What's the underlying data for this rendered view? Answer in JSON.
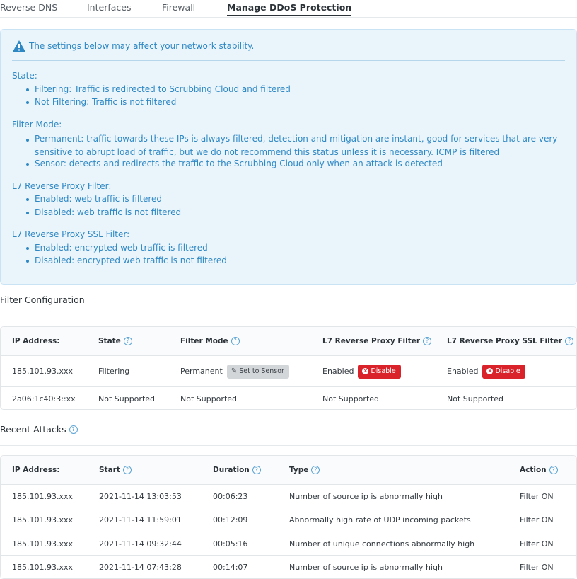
{
  "tabs": [
    {
      "label": "Reverse DNS"
    },
    {
      "label": "Interfaces"
    },
    {
      "label": "Firewall"
    },
    {
      "label": "Manage DDoS Protection"
    }
  ],
  "alert": {
    "warning": "The settings below may affect your network stability.",
    "sections": [
      {
        "title": "State:",
        "items": [
          "Filtering: Traffic is redirected to Scrubbing Cloud and filtered",
          "Not Filtering: Traffic is not filtered"
        ]
      },
      {
        "title": "Filter Mode:",
        "items": [
          "Permanent: traffic towards these IPs is always filtered, detection and mitigation are instant, good for services that are very sensitive to abrupt load of traffic, but we do not recommend this status unless it is necessary. ICMP is filtered",
          "Sensor: detects and redirects the traffic to the Scrubbing Cloud only when an attack is detected"
        ]
      },
      {
        "title": "L7 Reverse Proxy Filter:",
        "items": [
          "Enabled: web traffic is filtered",
          "Disabled: web traffic is not filtered"
        ]
      },
      {
        "title": "L7 Reverse Proxy SSL Filter:",
        "items": [
          "Enabled: encrypted web traffic is filtered",
          "Disabled: encrypted web traffic is not filtered"
        ]
      }
    ]
  },
  "filter_config": {
    "title": "Filter Configuration",
    "headers": [
      "IP Address:",
      "State",
      "Filter Mode",
      "L7 Reverse Proxy Filter",
      "L7 Reverse Proxy SSL Filter"
    ],
    "rows": [
      {
        "ip": "185.101.93.xxx",
        "state": "Filtering",
        "mode": "Permanent",
        "mode_button": "Set to Sensor",
        "l7": "Enabled",
        "l7_button": "Disable",
        "l7ssl": "Enabled",
        "l7ssl_button": "Disable"
      },
      {
        "ip": "2a06:1c40:3::xx",
        "state": "Not Supported",
        "mode": "Not Supported",
        "l7": "Not Supported",
        "l7ssl": "Not Supported"
      }
    ]
  },
  "recent_attacks": {
    "title": "Recent Attacks",
    "headers": [
      "IP Address:",
      "Start",
      "Duration",
      "Type",
      "Action"
    ],
    "rows": [
      {
        "ip": "185.101.93.xxx",
        "start": "2021-11-14 13:03:53",
        "duration": "00:06:23",
        "type": "Number of source ip is abnormally high",
        "action": "Filter ON"
      },
      {
        "ip": "185.101.93.xxx",
        "start": "2021-11-14 11:59:01",
        "duration": "00:12:09",
        "type": "Abnormally high rate of UDP incoming packets",
        "action": "Filter ON"
      },
      {
        "ip": "185.101.93.xxx",
        "start": "2021-11-14 09:32:44",
        "duration": "00:05:16",
        "type": "Number of unique connections abnormally high",
        "action": "Filter ON"
      },
      {
        "ip": "185.101.93.xxx",
        "start": "2021-11-14 07:43:28",
        "duration": "00:14:07",
        "type": "Number of source ip is abnormally high",
        "action": "Filter ON"
      }
    ]
  },
  "icons": {
    "warning": "warning-triangle-icon",
    "help": "question-circle-icon",
    "disable": "x-circle-icon",
    "edit": "pencil-icon"
  },
  "colors": {
    "info_text": "#2e88c4",
    "info_bg": "#eaf4fb",
    "danger": "#d9222a",
    "neutral_button": "#d3d6d9"
  }
}
